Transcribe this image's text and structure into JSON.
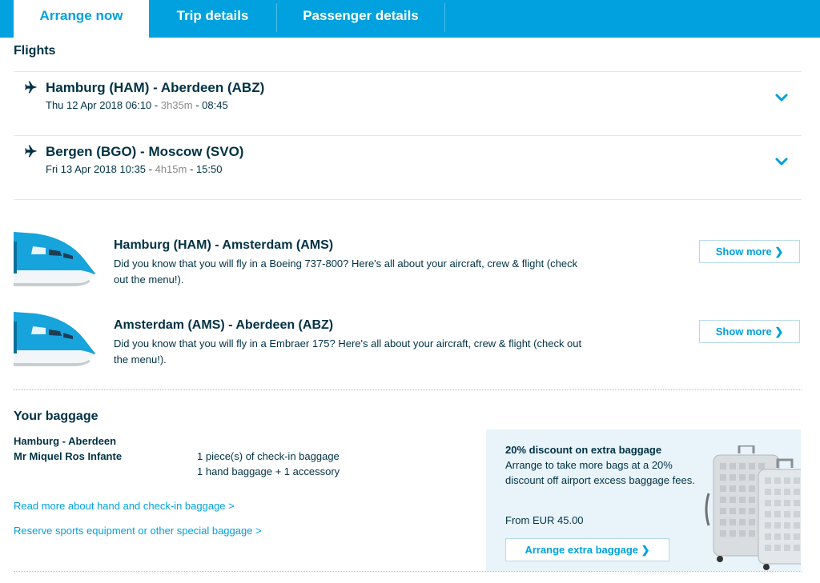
{
  "tabs": [
    {
      "label": "Arrange now",
      "active": true
    },
    {
      "label": "Trip details",
      "active": false
    },
    {
      "label": "Passenger details",
      "active": false
    }
  ],
  "flights_section": {
    "title": "Flights",
    "items": [
      {
        "route": "Hamburg (HAM) - Aberdeen (ABZ)",
        "date_dep": "Thu 12 Apr 2018 06:10",
        "sep1": " - ",
        "duration": "3h35m",
        "sep2": " - ",
        "arrival": "08:45",
        "icon": "plane-icon",
        "toggle_icon": "chevron-down-icon"
      },
      {
        "route": "Bergen (BGO) - Moscow (SVO)",
        "date_dep": "Fri 13 Apr 2018 10:35",
        "sep1": " - ",
        "duration": "4h15m",
        "sep2": " - ",
        "arrival": "15:50",
        "icon": "plane-icon",
        "toggle_icon": "chevron-down-icon"
      }
    ]
  },
  "aircraft_info": [
    {
      "title": "Hamburg (HAM) - Amsterdam (AMS)",
      "text": "Did you know that you will fly in a Boeing 737-800? Here's all about your aircraft, crew & flight (check out the menu!).",
      "button": "Show more ❯"
    },
    {
      "title": "Amsterdam (AMS) - Aberdeen (ABZ)",
      "text": "Did you know that you will fly in a Embraer 175? Here's all about your aircraft, crew & flight (check out the menu!).",
      "button": "Show more ❯"
    }
  ],
  "baggage": {
    "title": "Your baggage",
    "route": "Hamburg - Aberdeen",
    "passenger": "Mr Miquel Ros Infante",
    "checkin": "1 piece(s)  of check-in baggage",
    "hand": "1 hand baggage + 1 accessory",
    "link_hand_checkin": "Read more about hand and check-in baggage >",
    "link_sports": "Reserve sports equipment or other special baggage >"
  },
  "promo": {
    "title": "20% discount on extra baggage",
    "text": "Arrange to take more bags at a 20% discount off airport excess baggage fees.",
    "price": "From EUR 45.00",
    "button": "Arrange extra baggage ❯"
  },
  "colors": {
    "brand_blue": "#00a1de",
    "dark_navy": "#003145",
    "promo_bg": "#e8f4fa"
  }
}
